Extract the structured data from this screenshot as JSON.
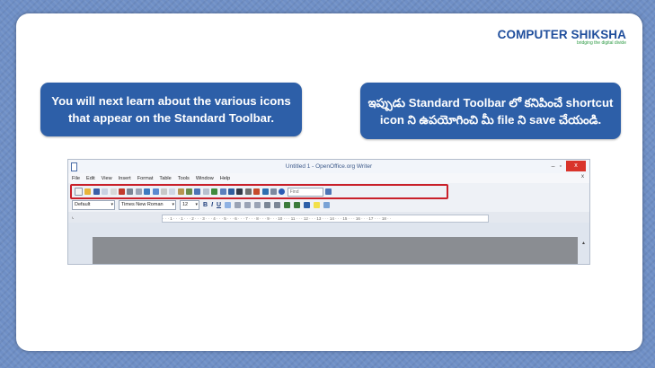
{
  "logo": {
    "name": "COMPUTER SHIKSHA",
    "tagline": "bridging the digital divide"
  },
  "callout_english": "You will next learn about the various icons that appear on the Standard Toolbar.",
  "callout_telugu": "ఇప్పుడు Standard Toolbar లో కనిపించే shortcut icon ని ఉపయోగించి మీ file ని save చేయండి.",
  "window": {
    "title": "Untitled 1 - OpenOffice.org Writer",
    "minimize": "–",
    "maximize": "▫",
    "close": "x",
    "doc_close": "x"
  },
  "menu": [
    "File",
    "Edit",
    "View",
    "Insert",
    "Format",
    "Table",
    "Tools",
    "Window",
    "Help"
  ],
  "standard_toolbar": {
    "icons": [
      "new-icon",
      "open-icon",
      "save-icon",
      "mail-icon",
      "edit-icon",
      "pdf-icon",
      "print-icon",
      "preview-icon",
      "spelling-icon",
      "autospell-icon",
      "cut-icon",
      "copy-icon",
      "paste-icon",
      "format-paintbrush-icon",
      "undo-icon",
      "redo-icon",
      "hyperlink-icon",
      "table-icon",
      "draw-icon",
      "navigator-icon",
      "gallery-icon",
      "datasource-icon",
      "nonprinting-icon",
      "zoom-icon",
      "help-icon"
    ],
    "find_placeholder": "Find"
  },
  "formatting_toolbar": {
    "style": "Default",
    "font": "Times New Roman",
    "size": "12",
    "bold": "B",
    "italic": "I",
    "underline": "U"
  },
  "ruler_text": "· · · 1 · · · 1 · · · 2 · · · 3 · · · 4 · · · 5 · · · 6 · · · 7 · · · 8 · · · 9 · · · 10 · · · 11 · · · 12 · · · 13 · · · 14 · · · 15 · · · 16 · · · 17 · · · 18 · ·",
  "colors": {
    "callout_bg": "#2d5fa8",
    "highlight": "#c9202a",
    "close_btn": "#d9342b"
  }
}
